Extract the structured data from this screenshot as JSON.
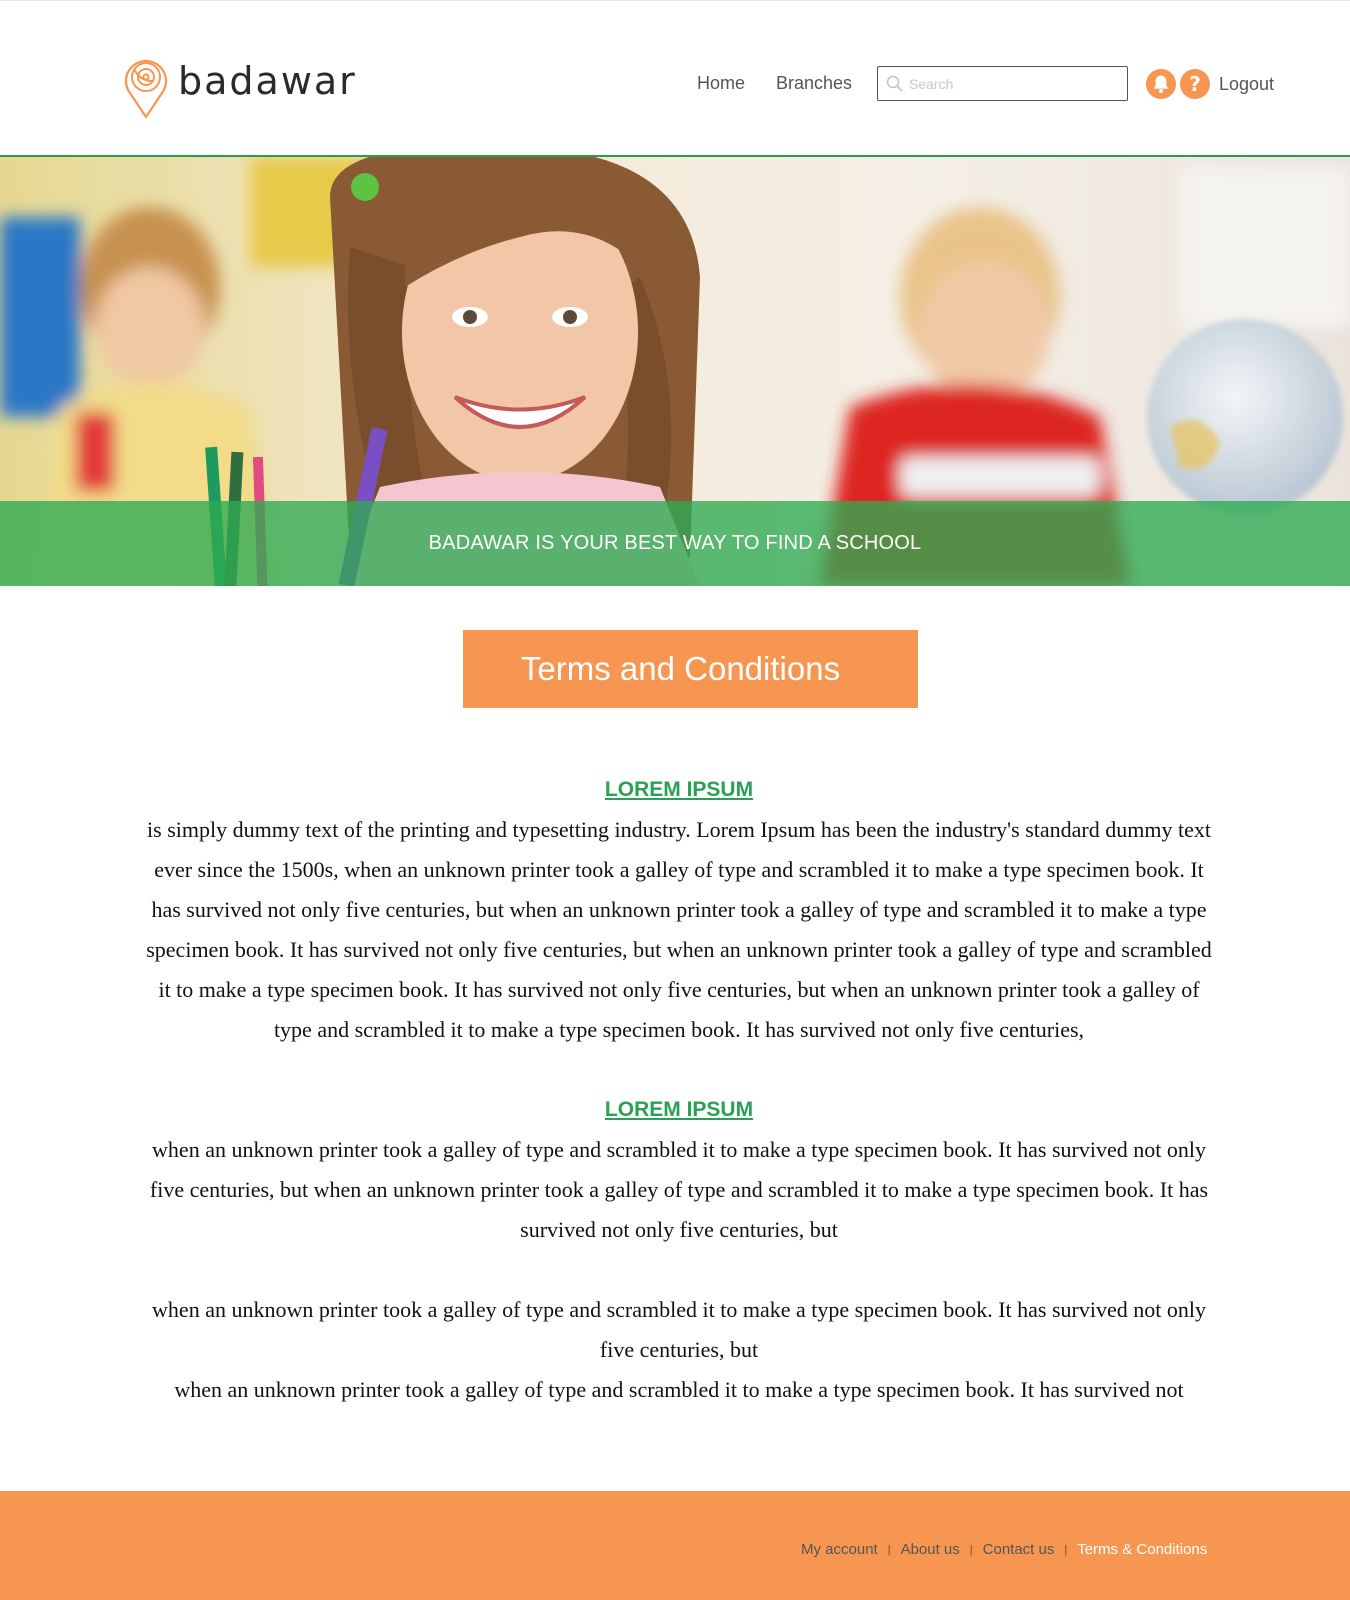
{
  "brand": {
    "name": "badawar"
  },
  "nav": {
    "home_label": "Home",
    "branches_label": "Branches",
    "logout_label": "Logout"
  },
  "search": {
    "placeholder": "Search",
    "value": ""
  },
  "hero": {
    "tagline": "BADAWAR IS YOUR BEST WAY TO FIND A SCHOOL"
  },
  "page_title": "Terms and Conditions",
  "sections": [
    {
      "heading": "LOREM IPSUM",
      "body": "is simply dummy text of the printing and typesetting industry. Lorem Ipsum has been the industry's standard dummy text ever since the 1500s, when an unknown printer took a galley of type and scrambled it to make a type specimen book. It has survived not only five centuries, but when an unknown printer took a galley of type and scrambled it to make a type specimen book. It has survived not only five centuries, but when an unknown printer took a galley of type and scrambled it to make a type specimen book. It has survived not only five centuries, but when an unknown printer took a galley of type and scrambled it to make a type specimen book. It has survived not only five centuries,"
    },
    {
      "heading": "LOREM IPSUM",
      "body": "when an unknown printer took a galley of type and scrambled it to make a type specimen book. It has survived not only five centuries, but when an unknown printer took a galley of type and scrambled it to make a type specimen book. It has survived not only five centuries, but"
    }
  ],
  "paragraphs": [
    "when an unknown printer took a galley of type and scrambled it to make a type specimen book. It has survived not only five centuries, but",
    "when an unknown printer took a galley of type and scrambled it to make a type specimen book. It has survived not"
  ],
  "footer": {
    "links": [
      "My account",
      "About us",
      "Contact us",
      "Terms & Conditions"
    ],
    "separator": "|"
  },
  "colors": {
    "accent_orange": "#f79650",
    "brand_green": "#2aa152",
    "hero_band_green": "#2eaa52"
  },
  "icons": [
    "logo-pin-icon",
    "search-icon",
    "bell-icon",
    "question-icon"
  ]
}
